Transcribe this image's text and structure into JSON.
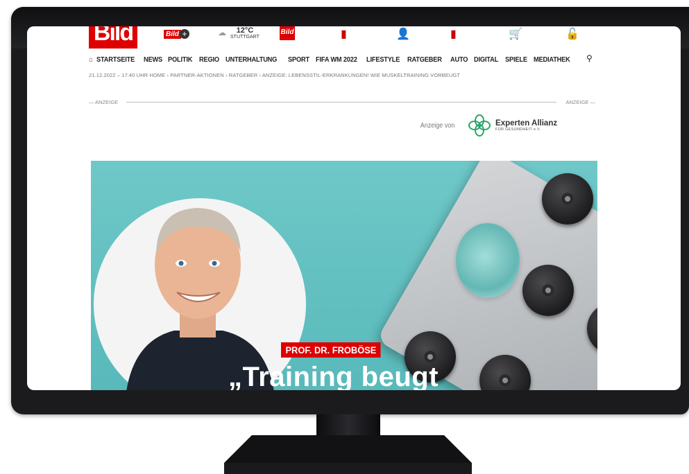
{
  "site": {
    "logo_text": "Bild",
    "bildplus_label": "Bild",
    "weather": {
      "temp": "12°C",
      "city": "STUTTGART"
    },
    "second_logo": "Bild",
    "brand_color": "#de0000"
  },
  "nav": {
    "items": [
      "STARTSEITE",
      "NEWS",
      "POLITIK",
      "REGIO",
      "UNTERHALTUNG",
      "SPORT",
      "FIFA WM 2022",
      "LIFESTYLE",
      "RATGEBER",
      "AUTO",
      "DIGITAL",
      "SPIELE",
      "MEDIATHEK"
    ]
  },
  "breadcrumb": "21.12.2022 – 17:40 UHR   HOME › PARTNER-AKTIONEN › RATGEBER › ANZEIGE: LEBENSSTIL-ERKRANKUNGEN! WIE MUSKELTRAINING VORBEUGT",
  "ad": {
    "left_label": "— ANZEIGE",
    "right_label": "ANZEIGE —",
    "sponsor_prefix": "Anzeige von",
    "sponsor_name": "Experten Allianz",
    "sponsor_sub": "FÜR GESUNDHEIT e.V."
  },
  "hero": {
    "kicker": "PROF. DR. FROBÖSE",
    "headline": "„Training beugt"
  },
  "icons": [
    "home-icon",
    "search-icon",
    "newspaper-icon",
    "person-card-icon",
    "phone-icon",
    "cart-icon",
    "lock-icon",
    "plus-icon"
  ]
}
